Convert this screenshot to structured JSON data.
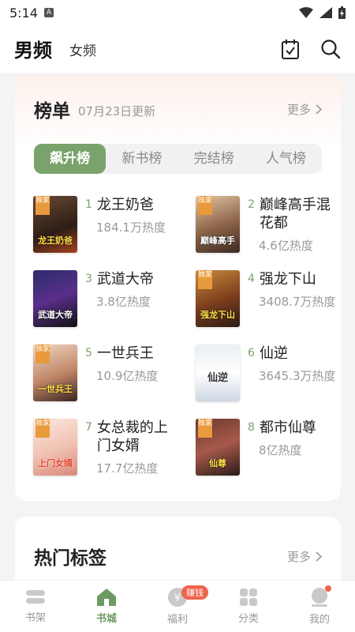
{
  "status": {
    "time": "5:14",
    "sim": "A"
  },
  "header": {
    "tab_male": "男频",
    "tab_female": "女频"
  },
  "rank": {
    "title": "榜单",
    "updated": "07月23日更新",
    "more": "更多",
    "tabs": [
      "飙升榜",
      "新书榜",
      "完结榜",
      "人气榜"
    ],
    "books": [
      {
        "num": "1",
        "name": "龙王奶爸",
        "heat": "184.1万热度",
        "badge": "独家",
        "cover_text": "龙王奶爸"
      },
      {
        "num": "2",
        "name": "巅峰高手混花都",
        "heat": "4.6亿热度",
        "badge": "独家",
        "cover_text": "巅峰高手"
      },
      {
        "num": "3",
        "name": "武道大帝",
        "heat": "3.8亿热度",
        "badge": "",
        "cover_text": "武道大帝"
      },
      {
        "num": "4",
        "name": "强龙下山",
        "heat": "3408.7万热度",
        "badge": "独家",
        "cover_text": "强龙下山"
      },
      {
        "num": "5",
        "name": "一世兵王",
        "heat": "10.9亿热度",
        "badge": "独家",
        "cover_text": "一世兵王"
      },
      {
        "num": "6",
        "name": "仙逆",
        "heat": "3645.3万热度",
        "badge": "",
        "cover_text": "仙逆"
      },
      {
        "num": "7",
        "name": "女总裁的上门女婿",
        "heat": "17.7亿热度",
        "badge": "独家",
        "cover_text": "上门女婿"
      },
      {
        "num": "8",
        "name": "都市仙尊",
        "heat": "8亿热度",
        "badge": "独家",
        "cover_text": "仙尊"
      }
    ]
  },
  "tags": {
    "title": "热门标签",
    "more": "更多"
  },
  "bottom_nav": [
    {
      "label": "书架",
      "icon": "bookshelf-icon"
    },
    {
      "label": "书城",
      "icon": "home-icon"
    },
    {
      "label": "福利",
      "icon": "coin-icon",
      "badge": "赚钱"
    },
    {
      "label": "分类",
      "icon": "grid-icon"
    },
    {
      "label": "我的",
      "icon": "profile-icon"
    }
  ],
  "colors": {
    "accent": "#79a26c",
    "badge": "#e89a3c",
    "alert": "#f0634a"
  }
}
